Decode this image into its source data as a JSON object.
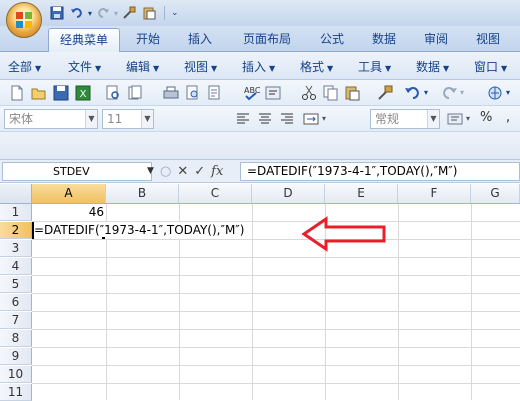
{
  "title_bar": {
    "qat_icons": [
      "save-icon",
      "undo-icon",
      "redo-icon",
      "format-painter-icon",
      "paste-icon"
    ]
  },
  "ribbon_tabs": [
    "经典菜单",
    "开始",
    "插入",
    "页面布局",
    "公式",
    "数据",
    "审阅",
    "视图"
  ],
  "active_tab": "经典菜单",
  "menu": [
    "全部",
    "文件",
    "编辑",
    "视图",
    "插入",
    "格式",
    "工具",
    "数据",
    "窗口"
  ],
  "toolbar": {
    "font_name": "宋体",
    "font_size": "11",
    "number_format": "常规",
    "percent_symbol": "%"
  },
  "formula_bar": {
    "name_box": "STDEV",
    "fx_label": "fx",
    "cancel_symbol": "✕",
    "enter_symbol": "✓",
    "formula": "=DATEDIF(″1973-4-1″,TODAY(),″M″)"
  },
  "grid": {
    "columns": [
      "A",
      "B",
      "C",
      "D",
      "E",
      "F",
      "G"
    ],
    "rows": [
      "1",
      "2",
      "3",
      "4",
      "5",
      "6",
      "7",
      "8",
      "9",
      "10",
      "11"
    ],
    "selected_column": "A",
    "selected_row": "2",
    "cells": {
      "A1": "46",
      "A2": "=DATEDIF(″1973-4-1″,TODAY(),″M″)"
    }
  },
  "colors": {
    "annotation_arrow": "#e8202a",
    "selection_header": "#f1c15f",
    "tab_text": "#15428b"
  }
}
